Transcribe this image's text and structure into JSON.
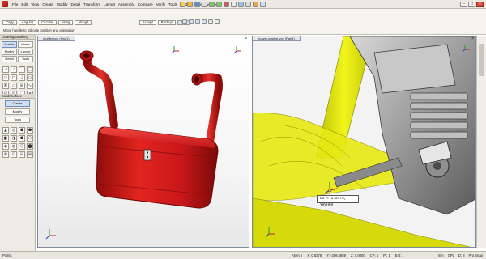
{
  "menu": {
    "items": [
      "File",
      "Edit",
      "View",
      "Create",
      "Modify",
      "Detail",
      "Transform",
      "Layout",
      "Assembly",
      "Compare",
      "Verify",
      "Tools",
      "Add-ins",
      "Window",
      "Help"
    ],
    "window_controls": [
      "–",
      "□",
      "×"
    ]
  },
  "command_bar": {
    "buttons": [
      "Copy",
      "Angular",
      "Circular",
      "Along",
      "Along6"
    ],
    "right_buttons": [
      "Accept",
      "Backup",
      "Esc"
    ],
    "hint": "Move handle to indicate position and orientation"
  },
  "left_panel": {
    "top_title": "Drawing/Detailing",
    "top_buttons": [
      "Create",
      "Warm",
      "Modify",
      "Layout",
      "Detail",
      "Tools"
    ],
    "tools_icons": [
      "↗",
      "○",
      "⌒",
      "◯",
      "□",
      "⊓",
      "⊥",
      "▭",
      "⌘",
      "◇",
      "⊞",
      "∿",
      "◱",
      "◰",
      "⬚",
      "⌗"
    ],
    "bottom_title": "Solid/Surface",
    "bottom_buttons": [
      "Create",
      "Modify",
      "Tools"
    ],
    "bottom_icons": [
      "◭",
      "◎",
      "⬢",
      "⬣",
      "◧",
      "◨",
      "⬟",
      "⬠",
      "◉",
      "◍",
      "⬡",
      "⬤",
      "⊠",
      "⊡",
      "⊟",
      "⊞"
    ]
  },
  "viewports": {
    "left_tab": "muffler.vcd (Part1)",
    "right_tab": "mower-engine.vcd (Part1)",
    "close_glyph": "×"
  },
  "readout": "DX = 3.5475, YHVHHH",
  "status": {
    "left": "Points",
    "fields": [
      "Atom 5",
      "X: 0.8378",
      "Y: -289.8659",
      "Z: 0.0000",
      "CP: 1",
      "Pt: 1",
      "Ent: 1"
    ],
    "right": [
      "mm",
      "CPL",
      "D: 8",
      "Pro Snap"
    ]
  },
  "colors": {
    "muffler_red": "#d81f1a",
    "frame_yellow": "#e5e80c",
    "engine_gray": "#8a8a8a",
    "accent_blue": "#6f8fb8"
  }
}
